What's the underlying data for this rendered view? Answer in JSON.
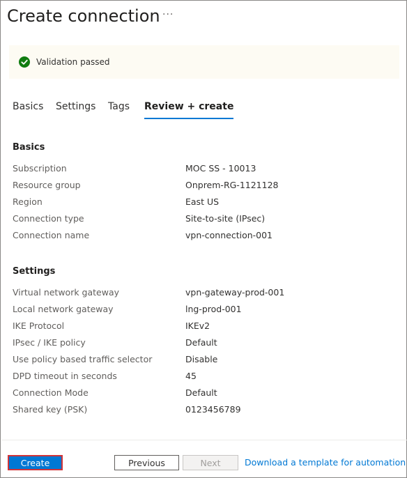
{
  "header": {
    "title": "Create connection",
    "more_label": "···"
  },
  "validation": {
    "message": "Validation passed",
    "status_color": "#107c10",
    "icon": "checkmark-circle-icon"
  },
  "tabs": [
    {
      "label": "Basics"
    },
    {
      "label": "Settings"
    },
    {
      "label": "Tags"
    },
    {
      "label": "Review + create",
      "active": true
    }
  ],
  "basics": {
    "title": "Basics",
    "rows": [
      {
        "label": "Subscription",
        "value": "MOC SS - 10013"
      },
      {
        "label": "Resource group",
        "value": "Onprem-RG-1121128"
      },
      {
        "label": "Region",
        "value": "East US"
      },
      {
        "label": "Connection type",
        "value": "Site-to-site (IPsec)"
      },
      {
        "label": "Connection name",
        "value": "vpn-connection-001"
      }
    ]
  },
  "settings": {
    "title": "Settings",
    "rows": [
      {
        "label": "Virtual network gateway",
        "value": "vpn-gateway-prod-001"
      },
      {
        "label": "Local network gateway",
        "value": "lng-prod-001"
      },
      {
        "label": "IKE Protocol",
        "value": "IKEv2"
      },
      {
        "label": "IPsec / IKE policy",
        "value": "Default"
      },
      {
        "label": "Use policy based traffic selector",
        "value": "Disable"
      },
      {
        "label": "DPD timeout in seconds",
        "value": "45"
      },
      {
        "label": "Connection Mode",
        "value": "Default"
      },
      {
        "label": "Shared key (PSK)",
        "value": "0123456789"
      }
    ]
  },
  "footer": {
    "create_label": "Create",
    "previous_label": "Previous",
    "next_label": "Next",
    "template_link": "Download a template for automation",
    "accent_color": "#0078d4",
    "highlight_color": "#d13438"
  }
}
